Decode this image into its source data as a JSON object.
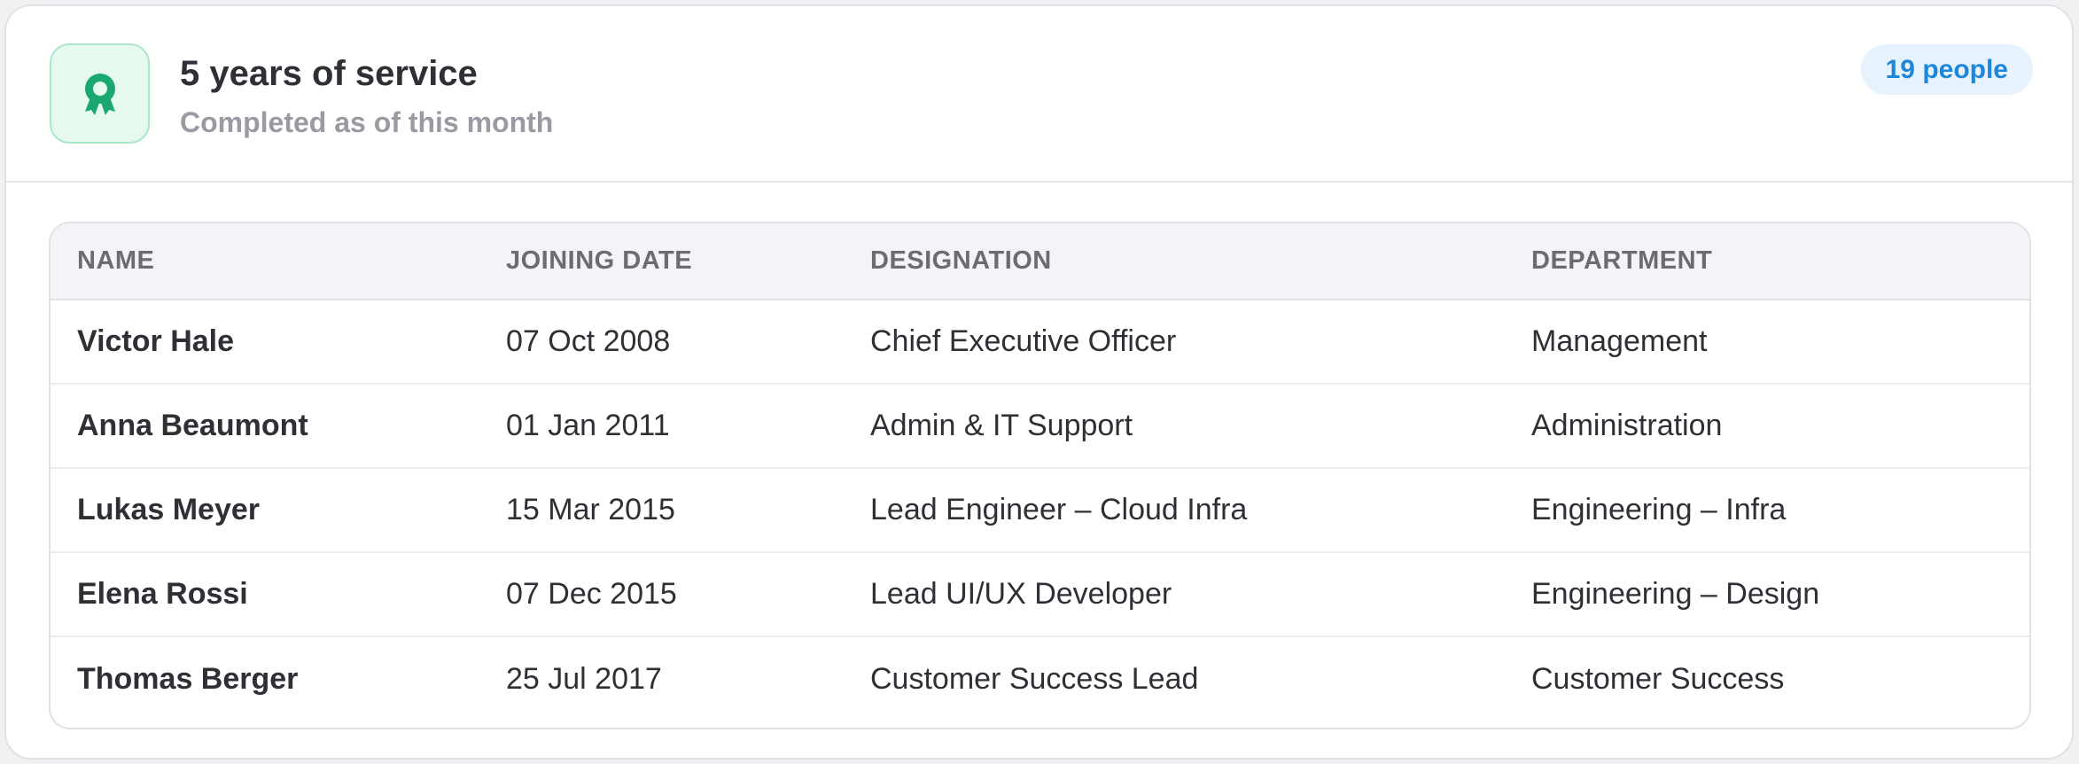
{
  "header": {
    "icon": "award-ribbon-icon",
    "title": "5 years of service",
    "subtitle": "Completed as of this month",
    "count_badge": "19 people"
  },
  "colors": {
    "accent_green": "#1aa870",
    "badge_blue": "#1f87d9"
  },
  "table": {
    "columns": [
      "NAME",
      "JOINING DATE",
      "DESIGNATION",
      "DEPARTMENT"
    ],
    "rows": [
      {
        "name": "Victor Hale",
        "joining_date": "07 Oct 2008",
        "designation": "Chief Executive Officer",
        "department": "Management"
      },
      {
        "name": "Anna Beaumont",
        "joining_date": "01 Jan 2011",
        "designation": "Admin & IT Support",
        "department": "Administration"
      },
      {
        "name": "Lukas Meyer",
        "joining_date": "15 Mar 2015",
        "designation": "Lead Engineer – Cloud Infra",
        "department": "Engineering – Infra"
      },
      {
        "name": "Elena Rossi",
        "joining_date": "07 Dec 2015",
        "designation": "Lead UI/UX Developer",
        "department": "Engineering – Design"
      },
      {
        "name": "Thomas Berger",
        "joining_date": "25 Jul 2017",
        "designation": "Customer Success Lead",
        "department": "Customer Success"
      }
    ]
  }
}
